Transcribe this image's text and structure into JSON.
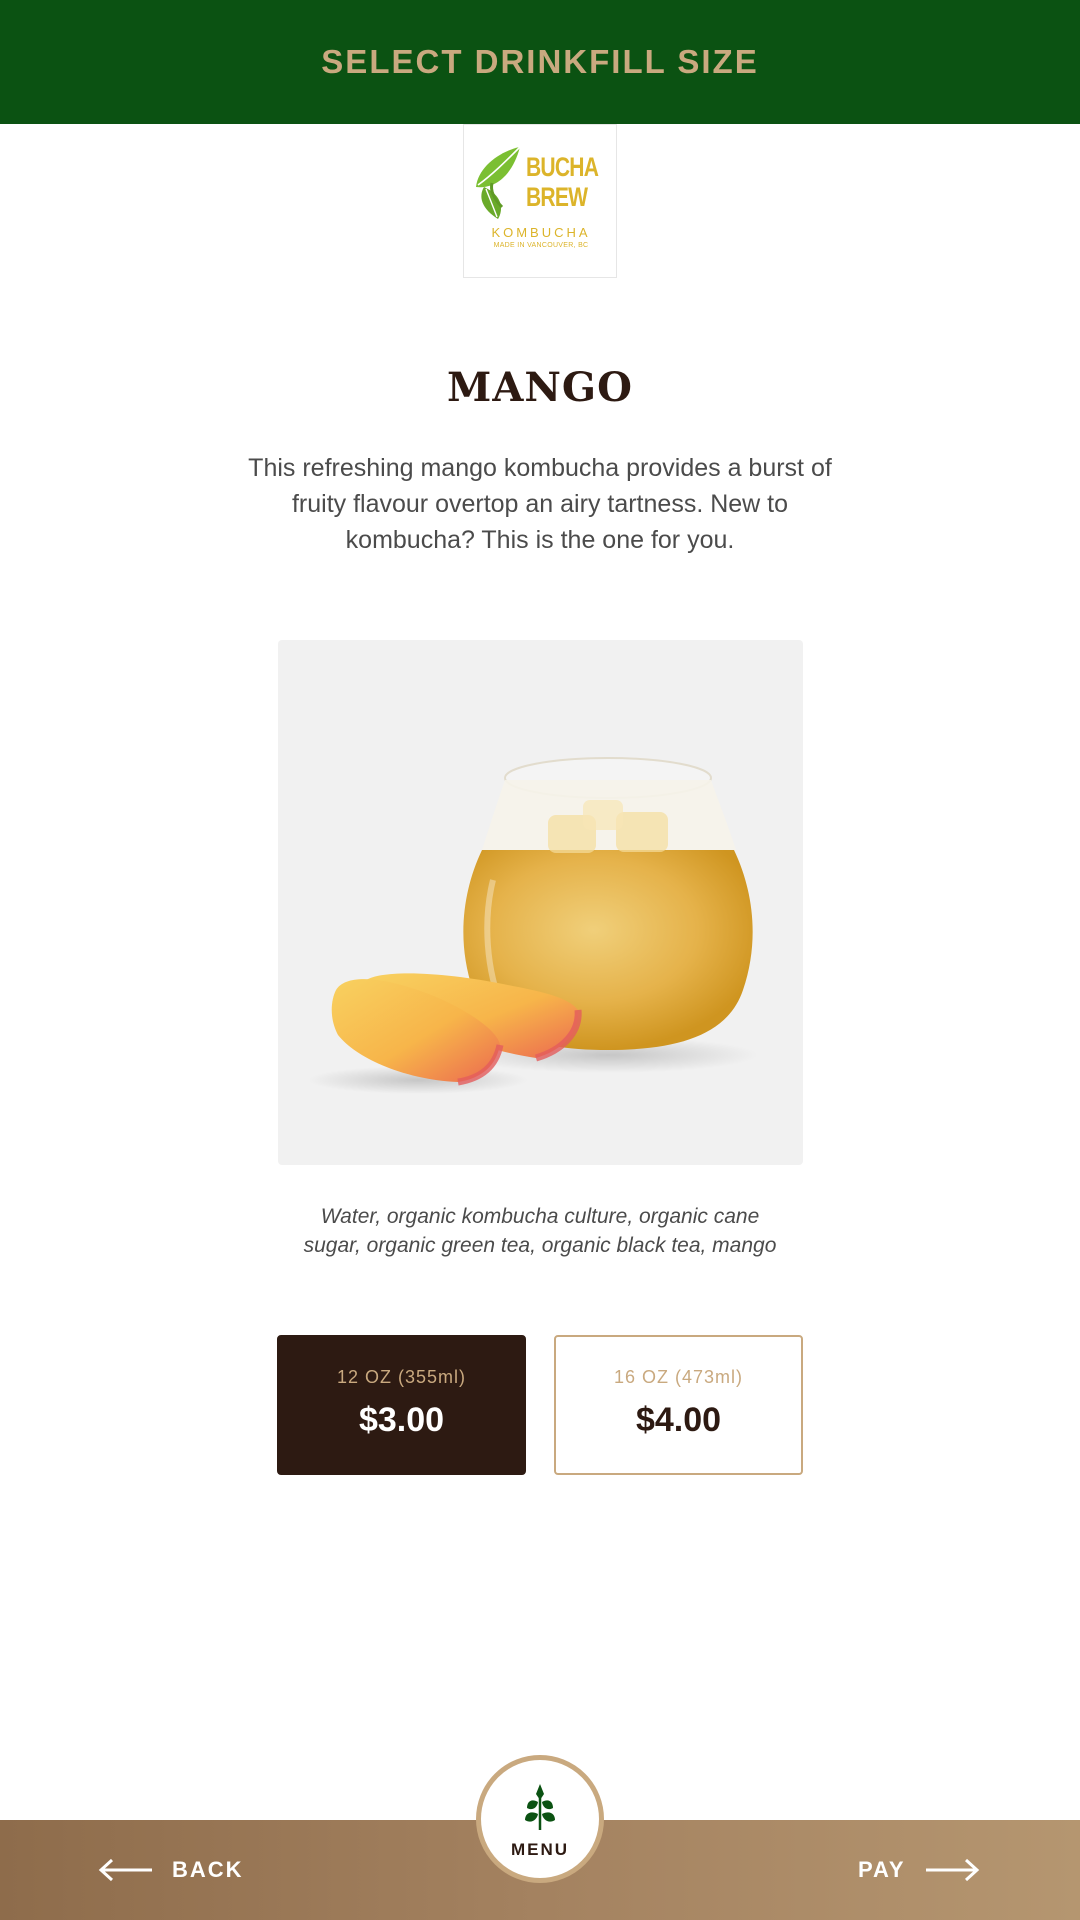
{
  "header": {
    "title": "SELECT DRINKFILL SIZE"
  },
  "logo": {
    "line1": "BUCHA",
    "line2": "BREW",
    "subtitle": "KOMBUCHA",
    "tagline": "MADE IN VANCOUVER, BC"
  },
  "product": {
    "name": "MANGO",
    "description": "This refreshing mango kombucha provides a burst of fruity flavour overtop an airy tartness. New to kombucha? This is the one for you.",
    "ingredients": "Water, organic kombucha culture, organic cane sugar, organic green tea, organic black tea, mango"
  },
  "sizes": [
    {
      "label": "12 OZ (355ml)",
      "price": "$3.00",
      "selected": true
    },
    {
      "label": "16 OZ (473ml)",
      "price": "$4.00",
      "selected": false
    }
  ],
  "footer": {
    "back_label": "BACK",
    "pay_label": "PAY",
    "menu_label": "MENU"
  },
  "colors": {
    "header_bg": "#0b5212",
    "accent_tan": "#c9a97f",
    "dark_brown": "#2d1a12",
    "logo_yellow": "#dcb42a",
    "logo_green": "#7bbf32"
  },
  "icons": {
    "back": "arrow-left-icon",
    "pay": "arrow-right-icon",
    "menu": "leaf-icon",
    "logo": "leaf-logo-icon"
  }
}
